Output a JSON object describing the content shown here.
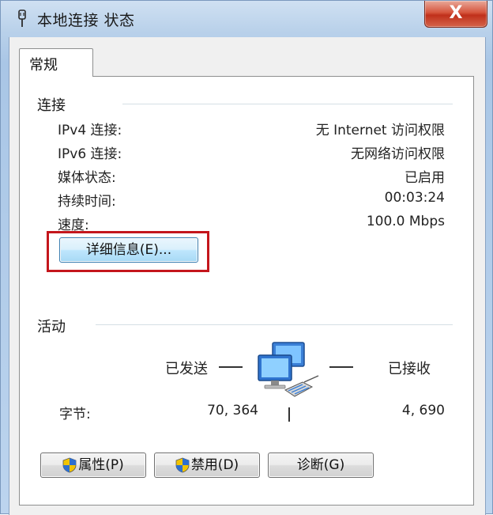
{
  "window": {
    "title": "本地连接 状态",
    "close_label": "X"
  },
  "tabs": [
    {
      "label": "常规"
    }
  ],
  "connection": {
    "title": "连接",
    "rows": [
      {
        "label": "IPv4 连接:",
        "value": "无 Internet 访问权限"
      },
      {
        "label": "IPv6 连接:",
        "value": "无网络访问权限"
      },
      {
        "label": "媒体状态:",
        "value": "已启用"
      },
      {
        "label": "持续时间:",
        "value": "00:03:24"
      },
      {
        "label": "速度:",
        "value": "100.0 Mbps"
      }
    ],
    "details_button": "详细信息(E)..."
  },
  "activity": {
    "title": "活动",
    "sent_label": "已发送",
    "received_label": "已接收",
    "bytes_label": "字节:",
    "bytes_sent": "70, 364",
    "bytes_received": "4, 690"
  },
  "buttons": {
    "properties": "属性(P)",
    "disable": "禁用(D)",
    "diagnose": "诊断(G)"
  },
  "colors": {
    "highlight": "#c4161c",
    "close_button": "#c0301b"
  }
}
